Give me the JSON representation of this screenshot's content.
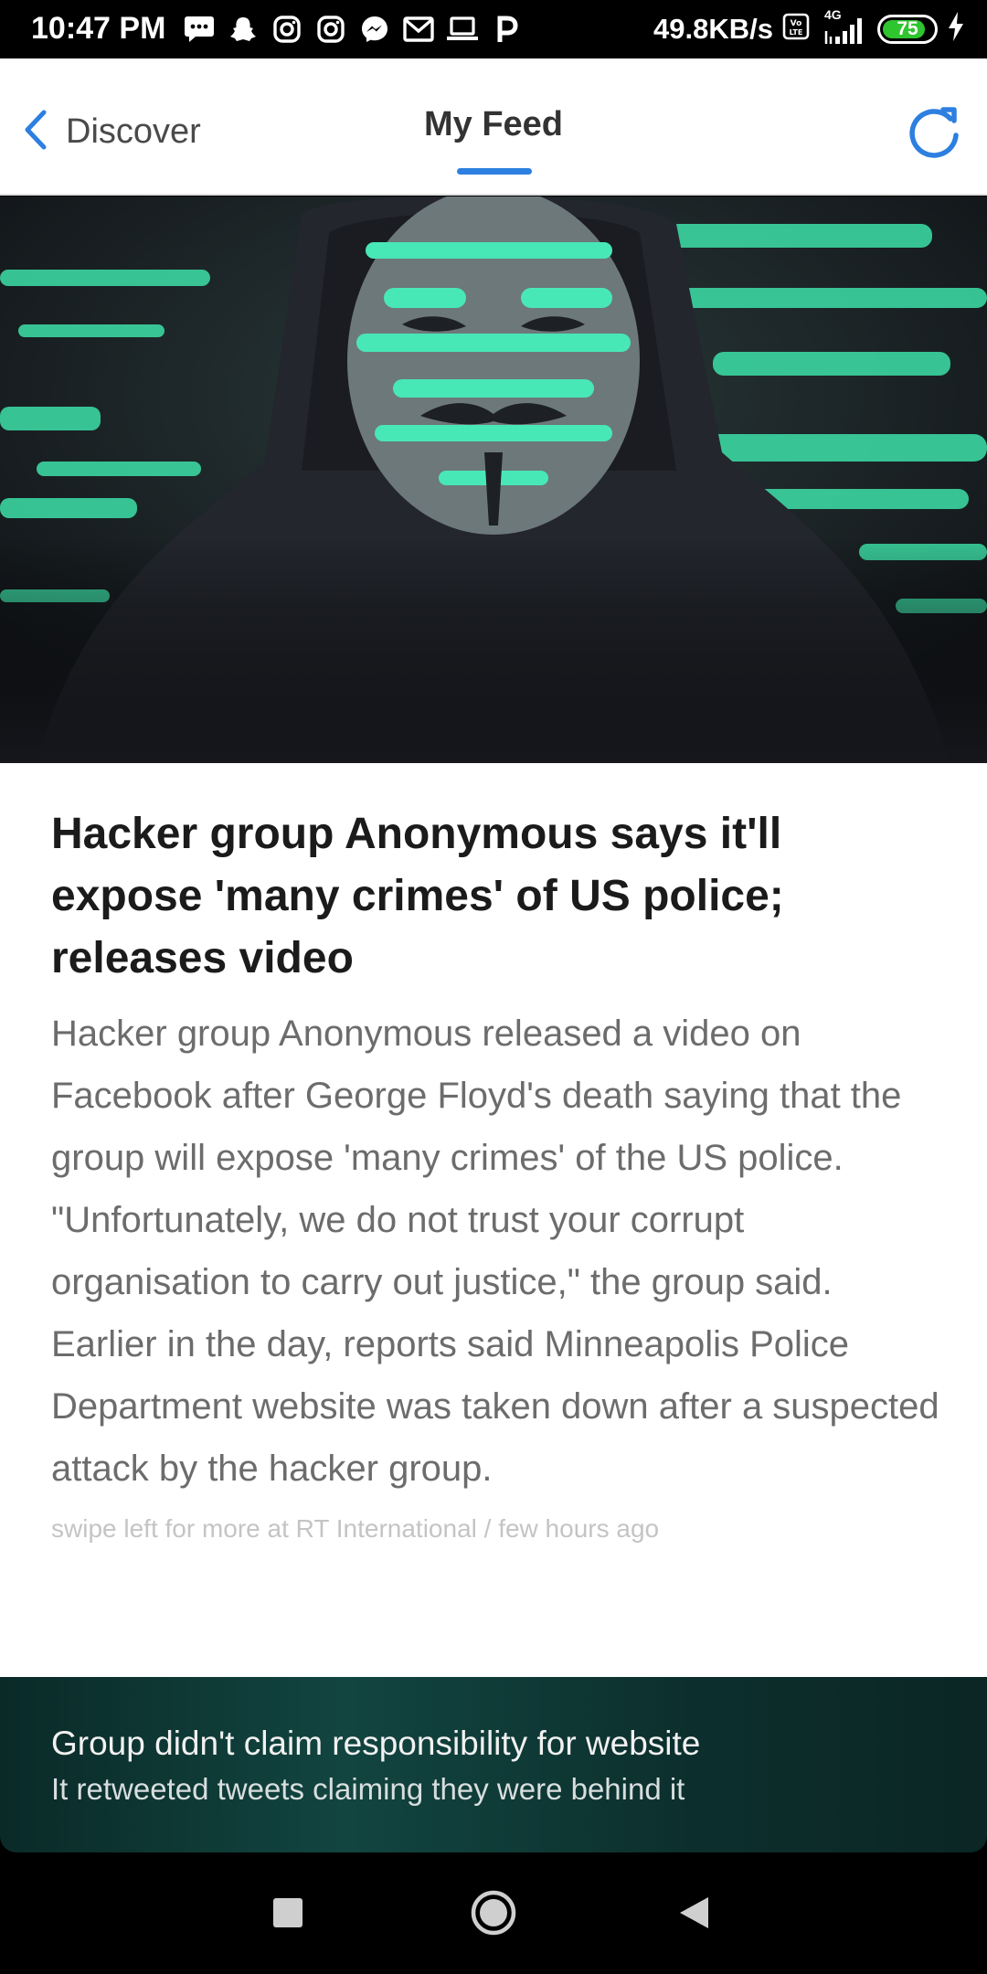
{
  "status_bar": {
    "time": "10:47 PM",
    "network_speed": "49.8KB/s",
    "network_type": "4G",
    "battery_level": "75",
    "icons": [
      "message-icon",
      "snapchat-icon",
      "instagram-icon",
      "instagram-icon",
      "messenger-icon",
      "gmail-icon",
      "laptop-icon",
      "p-icon",
      "volte-icon",
      "signal-icon",
      "battery-icon",
      "charging-icon"
    ]
  },
  "header": {
    "back_label": "Discover",
    "active_tab": "My Feed",
    "accent_color": "#2d7fe0"
  },
  "article": {
    "headline": "Hacker group Anonymous says it'll expose 'many crimes' of US police; releases video",
    "body": "Hacker group Anonymous released a video on Facebook after George Floyd's death saying that the group will expose 'many crimes' of the US police. \"Unfortunately, we do not trust your corrupt organisation to carry out justice,\" the group said. Earlier in the day, reports said Minneapolis Police Department website was taken down after a suspected attack by the hacker group.",
    "source_line": "swipe left for more at RT International / few hours ago"
  },
  "bottom_card": {
    "title": "Group didn't claim responsibility for website",
    "subtitle": "It retweeted tweets claiming they were behind it"
  },
  "nav_bar": {
    "buttons": [
      "recents-square-icon",
      "home-circle-icon",
      "back-triangle-icon"
    ]
  }
}
